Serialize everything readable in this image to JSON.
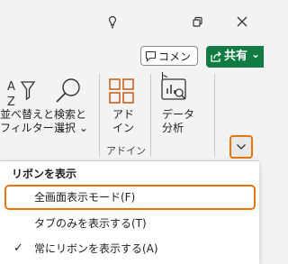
{
  "colors": {
    "accent": "#e8740c",
    "share_green": "#107c41",
    "icon_orange": "#c55a11"
  },
  "titlebar": {
    "icons": [
      "lightbulb-icon",
      "restore-icon",
      "close-icon"
    ]
  },
  "header_buttons": {
    "comment_label": "コメント",
    "share_label": "共有",
    "share_chevron": "⌄"
  },
  "ribbon": {
    "sort": {
      "line1": "並べ替えと",
      "line2": "フィルター ⌄"
    },
    "find": {
      "line1": "検索と",
      "line2": "選択 ⌄"
    },
    "addin": {
      "line1": "アド",
      "line2": "イン",
      "group_label": "アドイン"
    },
    "analyze": {
      "line1": "データ",
      "line2": "分析"
    }
  },
  "ribbon_display_menu": {
    "header": "リボンを表示",
    "items": [
      {
        "label": "全画面表示モード(F)",
        "selected": true,
        "checked": false
      },
      {
        "label": "タブのみを表示する(T)",
        "selected": false,
        "checked": false
      },
      {
        "label": "常にリボンを表示する(A)",
        "selected": false,
        "checked": true
      }
    ],
    "check_glyph": "✓"
  }
}
